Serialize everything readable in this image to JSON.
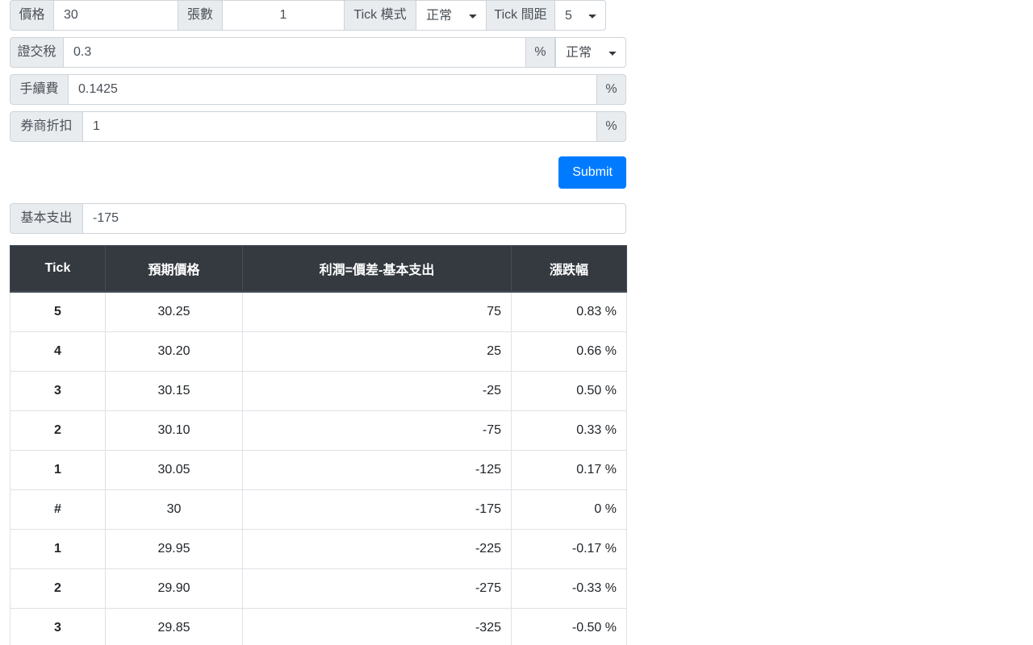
{
  "form": {
    "row_price": {
      "price_label": "價格",
      "price_value": "30",
      "qty_label": "張數",
      "qty_value": "1",
      "tick_mode_label": "Tick 模式",
      "tick_mode_value": "正常",
      "tick_gap_label": "Tick 間距",
      "tick_gap_value": "5"
    },
    "row_tax": {
      "label": "證交稅",
      "value": "0.3",
      "percent": "%",
      "mode_value": "正常"
    },
    "row_fee": {
      "label": "手續費",
      "value": "0.1425",
      "percent": "%"
    },
    "row_discount": {
      "label": "券商折扣",
      "value": "1",
      "percent": "%"
    },
    "submit_label": "Submit",
    "row_base_cost": {
      "label": "基本支出",
      "value": "-175"
    }
  },
  "table": {
    "headers": [
      "Tick",
      "預期價格",
      "利潤=價差-基本支出",
      "漲跌幅"
    ],
    "rows": [
      {
        "tick": "5",
        "dir": "up",
        "price": "30.25",
        "profit": "75",
        "pct": "0.83 %"
      },
      {
        "tick": "4",
        "dir": "up",
        "price": "30.20",
        "profit": "25",
        "pct": "0.66 %"
      },
      {
        "tick": "3",
        "dir": "up",
        "price": "30.15",
        "profit": "-25",
        "pct": "0.50 %"
      },
      {
        "tick": "2",
        "dir": "up",
        "price": "30.10",
        "profit": "-75",
        "pct": "0.33 %"
      },
      {
        "tick": "1",
        "dir": "up",
        "price": "30.05",
        "profit": "-125",
        "pct": "0.17 %"
      },
      {
        "tick": "#",
        "dir": "flat",
        "price": "30",
        "profit": "-175",
        "pct": "0 %"
      },
      {
        "tick": "1",
        "dir": "down",
        "price": "29.95",
        "profit": "-225",
        "pct": "-0.17 %"
      },
      {
        "tick": "2",
        "dir": "down",
        "price": "29.90",
        "profit": "-275",
        "pct": "-0.33 %"
      },
      {
        "tick": "3",
        "dir": "down",
        "price": "29.85",
        "profit": "-325",
        "pct": "-0.50 %"
      }
    ]
  },
  "colors": {
    "primary": "#007bff",
    "header_dark": "#343a40",
    "up": "#ff0000",
    "down": "#008000"
  }
}
